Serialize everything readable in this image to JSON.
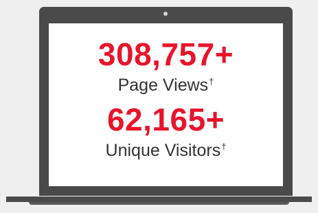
{
  "stats": [
    {
      "value": "308,757+",
      "label": "Page Views",
      "note_mark": "†"
    },
    {
      "value": "62,165+",
      "label": "Unique Visitors",
      "note_mark": "†"
    }
  ],
  "colors": {
    "accent": "#e8152b",
    "laptop_frame": "#4a4a4a",
    "background": "#efefef",
    "screen": "#ffffff",
    "label_text": "#333333"
  },
  "icons": [
    "laptop-icon",
    "webcam-icon"
  ]
}
